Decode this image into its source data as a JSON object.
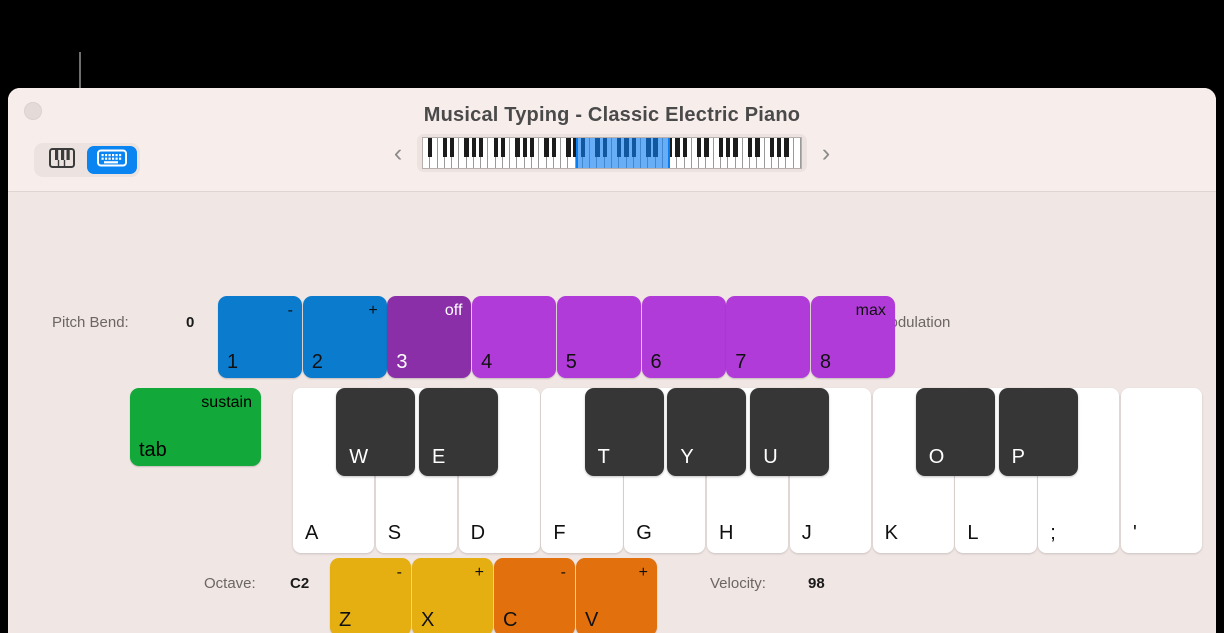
{
  "window": {
    "title": "Musical Typing - Classic Electric Piano",
    "close_button": "close",
    "nav_prev": "‹",
    "nav_next": "›"
  },
  "view_toggle": {
    "items": [
      {
        "icon": "piano-icon",
        "label": "Keyboard view",
        "active": false
      },
      {
        "icon": "computer-keyboard-icon",
        "label": "Musical Typing view",
        "active": true
      }
    ]
  },
  "pitch_bend": {
    "label": "Pitch Bend:",
    "value": "0"
  },
  "modulation": {
    "label": "Modulation"
  },
  "number_keys": [
    {
      "key": "1",
      "top": "-",
      "color": "#0b7bce",
      "key_color": "#111111",
      "top_color": "#111111"
    },
    {
      "key": "2",
      "top": "+",
      "color": "#0b7bce",
      "key_color": "#111111",
      "top_color": "#111111"
    },
    {
      "key": "3",
      "top": "off",
      "color": "#8b2fa8",
      "key_color": "#ffffff",
      "top_color": "#ffffff"
    },
    {
      "key": "4",
      "top": "",
      "color": "#b03bd8",
      "key_color": "#111111",
      "top_color": "#111111"
    },
    {
      "key": "5",
      "top": "",
      "color": "#b03bd8",
      "key_color": "#111111",
      "top_color": "#111111"
    },
    {
      "key": "6",
      "top": "",
      "color": "#b03bd8",
      "key_color": "#111111",
      "top_color": "#111111"
    },
    {
      "key": "7",
      "top": "",
      "color": "#b03bd8",
      "key_color": "#111111",
      "top_color": "#111111"
    },
    {
      "key": "8",
      "top": "max",
      "color": "#b03bd8",
      "key_color": "#111111",
      "top_color": "#111111"
    }
  ],
  "sustain": {
    "top_label": "sustain",
    "key_label": "tab",
    "color": "#13a83a"
  },
  "white_keys": [
    {
      "label": "A"
    },
    {
      "label": "S"
    },
    {
      "label": "D"
    },
    {
      "label": "F"
    },
    {
      "label": "G"
    },
    {
      "label": "H"
    },
    {
      "label": "J"
    },
    {
      "label": "K"
    },
    {
      "label": "L"
    },
    {
      "label": ";"
    },
    {
      "label": "'"
    }
  ],
  "black_keys": [
    {
      "label": "W"
    },
    {
      "label": "E"
    },
    {
      "label": "T"
    },
    {
      "label": "Y"
    },
    {
      "label": "U"
    },
    {
      "label": "O"
    },
    {
      "label": "P"
    }
  ],
  "octave": {
    "label": "Octave:",
    "value": "C2"
  },
  "velocity": {
    "label": "Velocity:",
    "value": "98"
  },
  "octave_keys": [
    {
      "key": "Z",
      "top": "-",
      "color": "#e5ae11"
    },
    {
      "key": "X",
      "top": "+",
      "color": "#e5ae11"
    }
  ],
  "velocity_keys": [
    {
      "key": "C",
      "top": "-",
      "color": "#e2700c"
    },
    {
      "key": "V",
      "top": "+",
      "color": "#e2700c"
    }
  ],
  "chart_data": null
}
